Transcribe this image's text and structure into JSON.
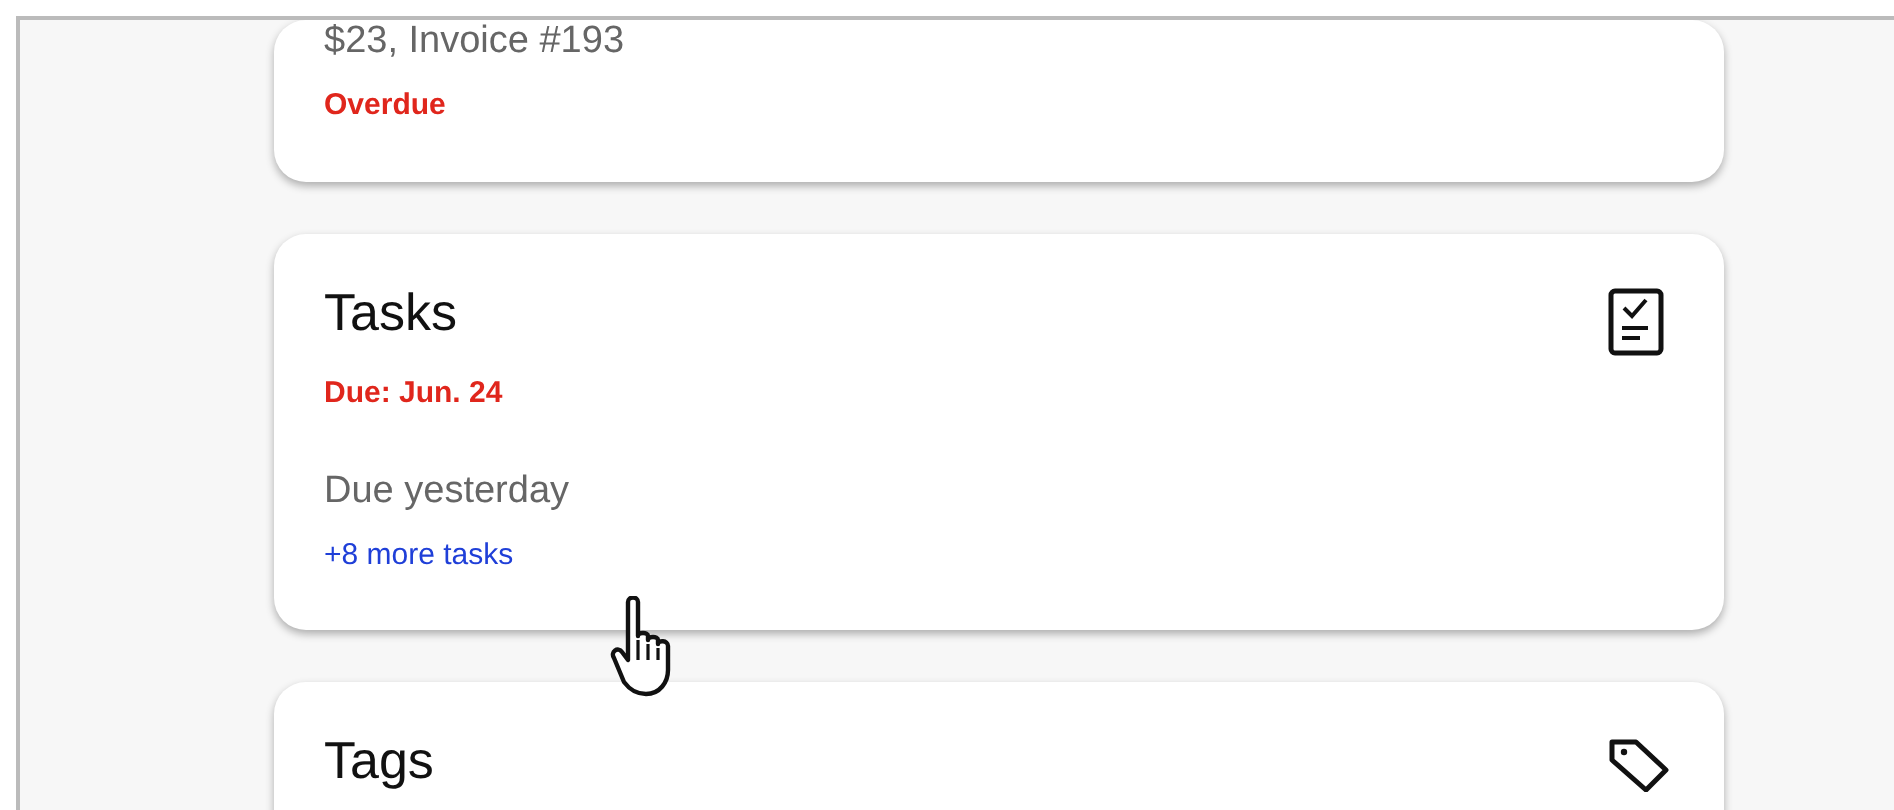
{
  "cards": [
    {
      "kind": "invoice",
      "lines": [
        {
          "kind": "detail",
          "text": "$23, Invoice #193"
        },
        {
          "kind": "alert",
          "text": "Overdue"
        }
      ]
    },
    {
      "kind": "tasks",
      "lines": [
        {
          "kind": "title",
          "text": "Tasks"
        },
        {
          "kind": "alert",
          "text": "Due: Jun. 24"
        },
        {
          "kind": "detail",
          "text": "Due yesterday"
        },
        {
          "kind": "link",
          "text": "+8 more tasks"
        }
      ]
    },
    {
      "kind": "tags",
      "lines": [
        {
          "kind": "title",
          "text": "Tags"
        }
      ]
    }
  ]
}
